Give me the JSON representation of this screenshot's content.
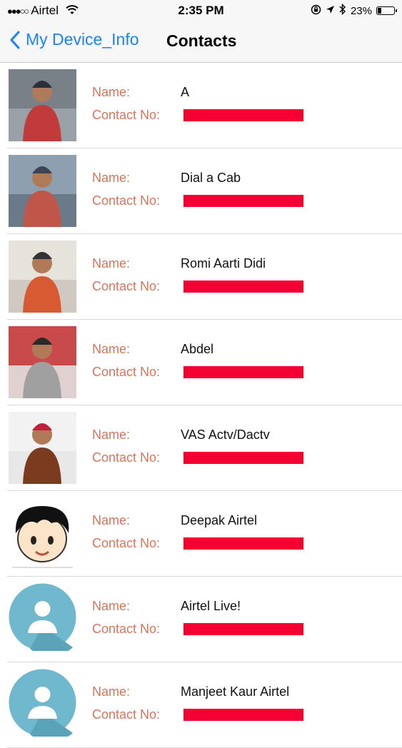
{
  "status": {
    "carrier": "Airtel",
    "signal_dots": "●●●○○",
    "time": "2:35 PM",
    "battery_percent": "23%",
    "battery_level": 0.23
  },
  "nav": {
    "back_label": "My Device_Info",
    "title": "Contacts"
  },
  "labels": {
    "name": "Name:",
    "contact": "Contact No:"
  },
  "contacts": [
    {
      "name": "A",
      "avatar": "photo"
    },
    {
      "name": "Dial a Cab",
      "avatar": "photo"
    },
    {
      "name": "Romi Aarti Didi",
      "avatar": "photo"
    },
    {
      "name": "Abdel",
      "avatar": "photo"
    },
    {
      "name": "VAS Actv/Dactv",
      "avatar": "photo"
    },
    {
      "name": "Deepak Airtel",
      "avatar": "cartoon-face"
    },
    {
      "name": "Airtel Live!",
      "avatar": "default-person"
    },
    {
      "name": "Manjeet Kaur Airtel",
      "avatar": "default-person"
    }
  ],
  "colors": {
    "accent": "#1a82fb",
    "label": "#d9745a",
    "redaction": "#f40033",
    "default_avatar": "#6fb8ce"
  }
}
